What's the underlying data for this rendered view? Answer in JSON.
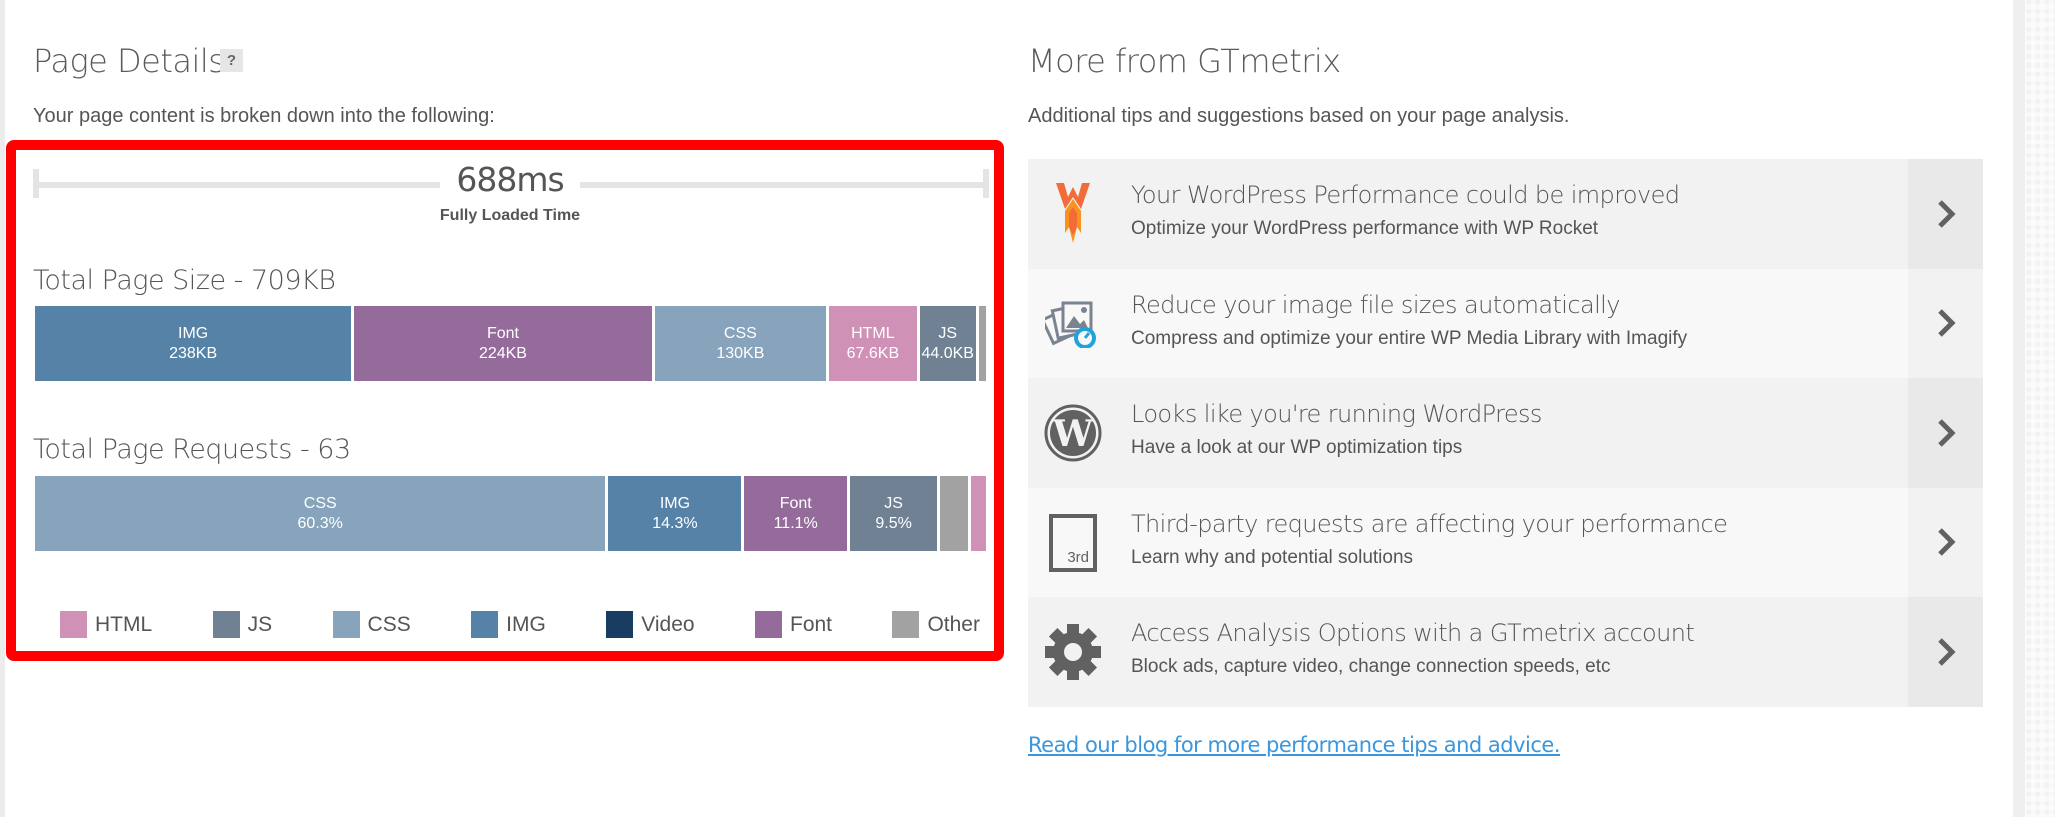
{
  "page_details": {
    "title": "Page Details",
    "help_label": "?",
    "subtitle": "Your page content is broken down into the following:",
    "fully_loaded": {
      "value": "688ms",
      "label": "Fully Loaded Time"
    },
    "page_size": {
      "title": "Total Page Size - 709KB",
      "segments": [
        {
          "type": "IMG",
          "label": "238KB",
          "value": 238,
          "color": "#5682a8"
        },
        {
          "type": "Font",
          "label": "224KB",
          "value": 224,
          "color": "#946b9a"
        },
        {
          "type": "CSS",
          "label": "130KB",
          "value": 130,
          "color": "#87a4bc"
        },
        {
          "type": "HTML",
          "label": "67.6KB",
          "value": 67.6,
          "color": "#cf91b5"
        },
        {
          "type": "JS",
          "label": "44.0KB",
          "value": 44.0,
          "color": "#6f8193"
        },
        {
          "type": "Other",
          "label": "",
          "value": 5.4,
          "color": "#a2a2a2"
        }
      ]
    },
    "page_requests": {
      "title": "Total Page Requests - 63",
      "segments": [
        {
          "type": "CSS",
          "label": "60.3%",
          "value": 60.3,
          "color": "#87a4bc"
        },
        {
          "type": "IMG",
          "label": "14.3%",
          "value": 14.3,
          "color": "#5682a8"
        },
        {
          "type": "Font",
          "label": "11.1%",
          "value": 11.1,
          "color": "#946b9a"
        },
        {
          "type": "JS",
          "label": "9.5%",
          "value": 9.5,
          "color": "#6f8193"
        },
        {
          "type": "Other",
          "label": "",
          "value": 3.2,
          "color": "#a2a2a2"
        },
        {
          "type": "HTML",
          "label": "",
          "value": 1.6,
          "color": "#cf91b5"
        }
      ]
    },
    "legend": [
      {
        "label": "HTML",
        "color": "#cf91b5"
      },
      {
        "label": "JS",
        "color": "#6f8193"
      },
      {
        "label": "CSS",
        "color": "#87a4bc"
      },
      {
        "label": "IMG",
        "color": "#5682a8"
      },
      {
        "label": "Video",
        "color": "#183c62"
      },
      {
        "label": "Font",
        "color": "#946b9a"
      },
      {
        "label": "Other",
        "color": "#a2a2a2"
      }
    ]
  },
  "more_from": {
    "title": "More from GTmetrix",
    "subtitle": "Additional tips and suggestions based on your page analysis.",
    "cards": [
      {
        "icon": "wp-rocket-icon",
        "title": "Your WordPress Performance could be improved",
        "desc": "Optimize your WordPress performance with WP Rocket"
      },
      {
        "icon": "imagify-icon",
        "title": "Reduce your image file sizes automatically",
        "desc": "Compress and optimize your entire WP Media Library with Imagify"
      },
      {
        "icon": "wordpress-icon",
        "title": "Looks like you're running WordPress",
        "desc": "Have a look at our WP optimization tips"
      },
      {
        "icon": "third-party-icon",
        "title": "Third-party requests are affecting your performance",
        "desc": "Learn why and potential solutions",
        "icon_text": "3rd"
      },
      {
        "icon": "gear-icon",
        "title": "Access Analysis Options with a GTmetrix account",
        "desc": "Block ads, capture video, change connection speeds, etc"
      }
    ],
    "blog_link": "Read our blog for more performance tips and advice."
  },
  "colors": {
    "highlight": "#ff0000",
    "link": "#3a96dd"
  }
}
